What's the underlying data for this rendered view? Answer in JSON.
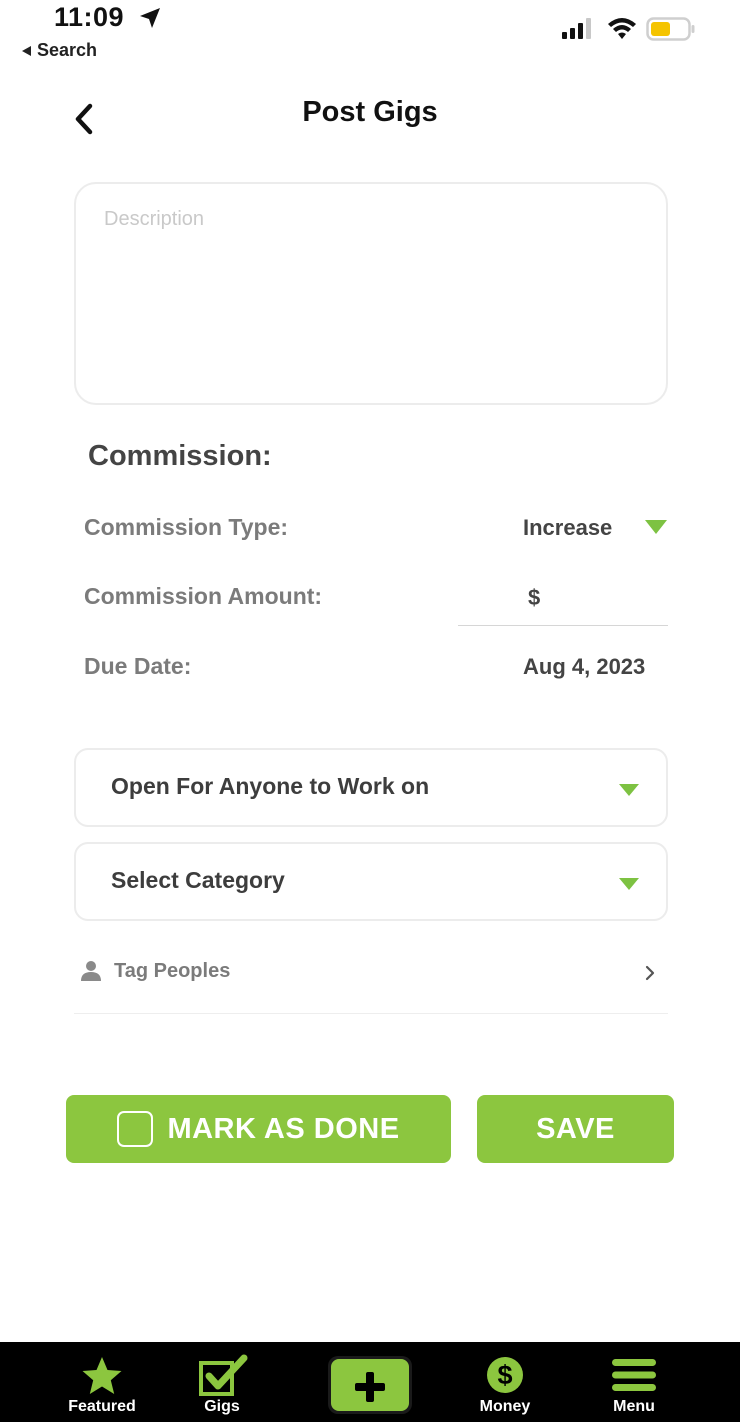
{
  "status_bar": {
    "time": "11:09",
    "back_label": "Search"
  },
  "header": {
    "title": "Post Gigs"
  },
  "description": {
    "placeholder": "Description",
    "value": ""
  },
  "commission": {
    "section_title": "Commission:",
    "type_label": "Commission Type:",
    "type_value": "Increase",
    "amount_label": "Commission Amount:",
    "amount_symbol": "$",
    "amount_value": "",
    "due_label": "Due Date:",
    "due_value": "Aug 4, 2023"
  },
  "selects": {
    "availability": "Open For Anyone to Work on",
    "category": "Select Category"
  },
  "tag_people": {
    "label": "Tag Peoples"
  },
  "buttons": {
    "mark_done": "MARK AS DONE",
    "save": "SAVE"
  },
  "tabbar": {
    "featured": "Featured",
    "gigs": "Gigs",
    "money": "Money",
    "menu": "Menu"
  },
  "colors": {
    "accent": "#8cc63f",
    "arrow": "#7dc242",
    "tabbar_bg": "#000000"
  }
}
